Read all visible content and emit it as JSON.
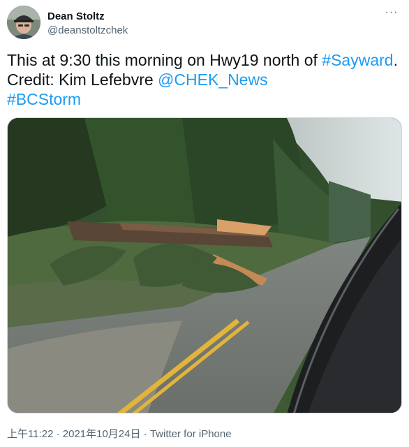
{
  "author": {
    "display_name": "Dean Stoltz",
    "handle": "@deanstoltzchek"
  },
  "menu": {
    "more_icon": "more-horizontal-icon",
    "more_glyph": "···"
  },
  "tweet": {
    "text_before": "This at 9:30 this morning on Hwy19 north of ",
    "hashtag_1": "#Sayward",
    "text_middle": ". Credit: Kim Lefebvre ",
    "mention": "@CHEK_News",
    "hashtag_2": "#BCStorm"
  },
  "media": {
    "kind": "photo"
  },
  "meta": {
    "timestamp": "上午11:22 · 2021年10月24日",
    "separator": " · ",
    "source": "Twitter for iPhone"
  },
  "colors": {
    "link": "#1d9bf0",
    "secondary_text": "#536471",
    "primary_text": "#0f1419",
    "road_line": "#e2b43a"
  }
}
